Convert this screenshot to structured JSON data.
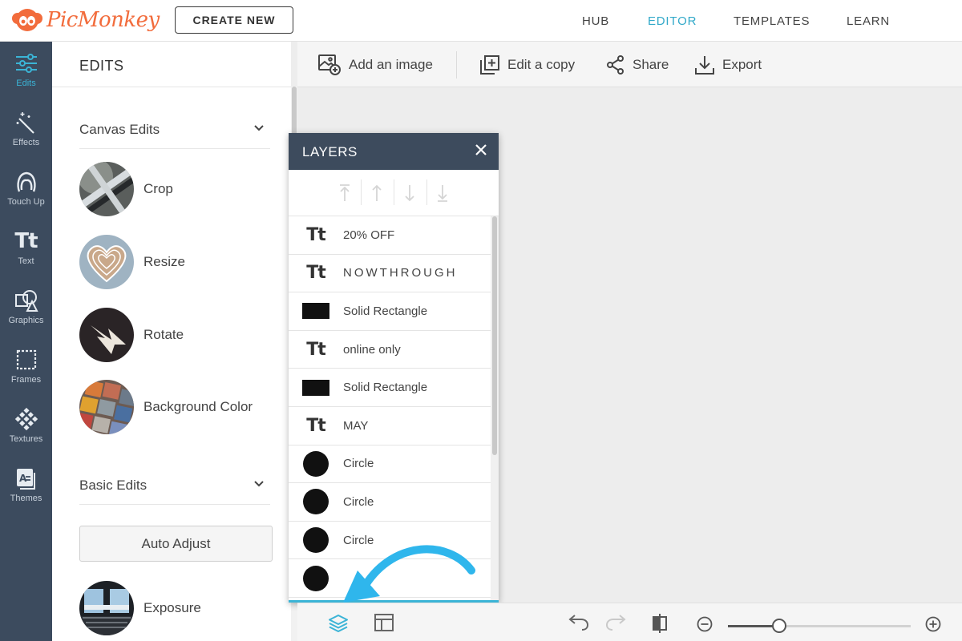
{
  "app": {
    "logo_text": "PicMonkey",
    "create_new": "CREATE NEW",
    "nav": [
      {
        "label": "HUB",
        "active": false
      },
      {
        "label": "EDITOR",
        "active": true
      },
      {
        "label": "TEMPLATES",
        "active": false
      },
      {
        "label": "LEARN",
        "active": false
      }
    ]
  },
  "rail": [
    {
      "label": "Edits",
      "icon": "sliders-icon",
      "active": true
    },
    {
      "label": "Effects",
      "icon": "magic-wand-icon",
      "active": false
    },
    {
      "label": "Touch Up",
      "icon": "face-icon",
      "active": false
    },
    {
      "label": "Text",
      "icon": "text-icon",
      "active": false
    },
    {
      "label": "Graphics",
      "icon": "shapes-icon",
      "active": false
    },
    {
      "label": "Frames",
      "icon": "frame-icon",
      "active": false
    },
    {
      "label": "Textures",
      "icon": "texture-icon",
      "active": false
    },
    {
      "label": "Themes",
      "icon": "themes-icon",
      "active": false
    }
  ],
  "edits": {
    "title": "EDITS",
    "canvas_section": "Canvas Edits",
    "canvas_items": [
      "Crop",
      "Resize",
      "Rotate",
      "Background Color"
    ],
    "basic_section": "Basic Edits",
    "auto_adjust": "Auto Adjust",
    "basic_items": [
      "Exposure"
    ]
  },
  "toolbar": {
    "add_image": "Add an image",
    "edit_copy": "Edit a copy",
    "share": "Share",
    "export": "Export"
  },
  "layers": {
    "title": "LAYERS",
    "items": [
      {
        "type": "text",
        "label": "20% OFF"
      },
      {
        "type": "text",
        "label": "NOWTHROUGH"
      },
      {
        "type": "rect",
        "label": "Solid Rectangle"
      },
      {
        "type": "text",
        "label": "online only"
      },
      {
        "type": "rect",
        "label": "Solid Rectangle"
      },
      {
        "type": "text",
        "label": "MAY"
      },
      {
        "type": "circle",
        "label": "Circle"
      },
      {
        "type": "circle",
        "label": "Circle"
      },
      {
        "type": "circle",
        "label": "Circle"
      },
      {
        "type": "circle",
        "label": ""
      }
    ]
  },
  "bottombar": {
    "zoom_level": 0.28
  },
  "colors": {
    "accent": "#3bb4d6",
    "rail_bg": "#3c4b5e",
    "logo": "#f26c3c"
  }
}
